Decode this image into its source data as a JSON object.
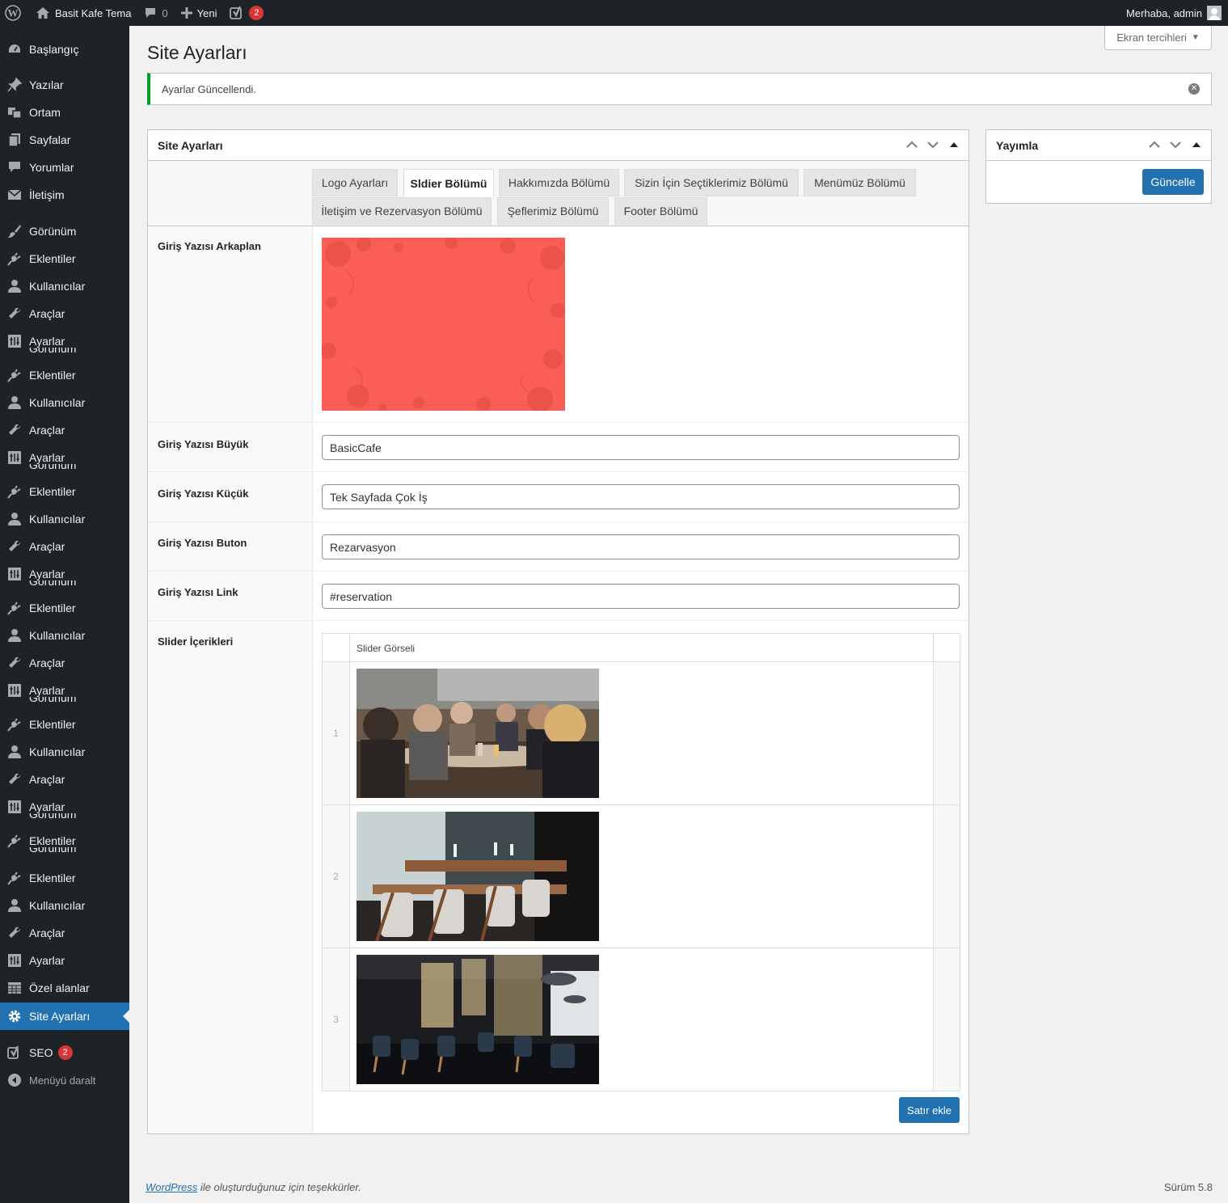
{
  "adminbar": {
    "site_name": "Basit Kafe Tema",
    "comments_count": "0",
    "new_label": "Yeni",
    "yoast_count": "2",
    "greeting": "Merhaba, admin"
  },
  "sidebar": {
    "items": [
      {
        "label": "Başlangıç",
        "icon": "dashboard-icon"
      },
      {
        "label": "Yazılar",
        "icon": "pin-icon"
      },
      {
        "label": "Ortam",
        "icon": "media-icon"
      },
      {
        "label": "Sayfalar",
        "icon": "pages-icon"
      },
      {
        "label": "Yorumlar",
        "icon": "comment-icon"
      },
      {
        "label": "İletişim",
        "icon": "mail-icon"
      },
      {
        "label": "Görünüm",
        "icon": "brush-icon"
      },
      {
        "label": "Eklentiler",
        "icon": "plugin-icon"
      },
      {
        "label": "Kullanıcılar",
        "icon": "user-icon"
      },
      {
        "label": "Araçlar",
        "icon": "wrench-icon"
      },
      {
        "label": "Ayarlar",
        "icon": "settings-grid-icon"
      },
      {
        "label": "Eklentiler",
        "icon": "plugin-icon"
      },
      {
        "label": "Kullanıcılar",
        "icon": "user-icon"
      },
      {
        "label": "Araçlar",
        "icon": "wrench-icon"
      },
      {
        "label": "Ayarlar",
        "icon": "settings-grid-icon"
      },
      {
        "label": "Eklentiler",
        "icon": "plugin-icon"
      },
      {
        "label": "Kullanıcılar",
        "icon": "user-icon"
      },
      {
        "label": "Araçlar",
        "icon": "wrench-icon"
      },
      {
        "label": "Ayarlar",
        "icon": "settings-grid-icon"
      },
      {
        "label": "Eklentiler",
        "icon": "plugin-icon"
      },
      {
        "label": "Kullanıcılar",
        "icon": "user-icon"
      },
      {
        "label": "Araçlar",
        "icon": "wrench-icon"
      },
      {
        "label": "Ayarlar",
        "icon": "settings-grid-icon"
      },
      {
        "label": "Eklentiler",
        "icon": "plugin-icon"
      },
      {
        "label": "Kullanıcılar",
        "icon": "user-icon"
      },
      {
        "label": "Araçlar",
        "icon": "wrench-icon"
      },
      {
        "label": "Ayarlar",
        "icon": "settings-grid-icon"
      },
      {
        "label": "Eklentiler",
        "icon": "plugin-icon"
      },
      {
        "label": "Eklentiler",
        "icon": "plugin-icon"
      },
      {
        "label": "Kullanıcılar",
        "icon": "user-icon"
      },
      {
        "label": "Araçlar",
        "icon": "wrench-icon"
      },
      {
        "label": "Ayarlar",
        "icon": "settings-grid-icon"
      },
      {
        "label": "Özel alanlar",
        "icon": "table-icon"
      },
      {
        "label": "Site Ayarları",
        "icon": "gear-icon"
      },
      {
        "label": "SEO",
        "icon": "yoast-icon",
        "badge": "2"
      },
      {
        "label": "Menüyü daralt",
        "icon": "collapse-icon"
      }
    ],
    "overlap_text": "Görünüm"
  },
  "screen_options": "Ekran tercihleri",
  "page_title": "Site Ayarları",
  "notice": "Ayarlar Güncellendi.",
  "main_box": {
    "title": "Site Ayarları",
    "tabs": [
      "Logo Ayarları",
      "Sldier Bölümü",
      "Hakkımızda Bölümü",
      "Sizin İçin Seçtiklerimiz Bölümü",
      "Menümüz Bölümü",
      "İletişim ve Rezervasyon Bölümü",
      "Şeflerimiz Bölümü",
      "Footer Bölümü"
    ],
    "active_tab": "Sldier Bölümü",
    "fields": {
      "bg_label": "Giriş Yazısı Arkaplan",
      "big_label": "Giriş Yazısı Büyük",
      "big_value": "BasicCafe",
      "small_label": "Giriş Yazısı Küçük",
      "small_value": "Tek Sayfada Çok İş",
      "button_label": "Giriş Yazısı Buton",
      "button_value": "Rezarvasyon",
      "link_label": "Giriş Yazısı Link",
      "link_value": "#reservation",
      "slider_label": "Slider İçerikleri"
    },
    "repeater": {
      "column": "Slider Görseli",
      "rows": [
        "1",
        "2",
        "3"
      ],
      "add_row": "Satır ekle"
    }
  },
  "publish_box": {
    "title": "Yayımla",
    "update": "Güncelle"
  },
  "footer": {
    "link": "WordPress",
    "thanks": " ile oluşturduğunuz için teşekkürler.",
    "version": "Sürüm 5.8"
  },
  "colors": {
    "admin_dark": "#1d2327",
    "accent": "#2271b1",
    "notice_success": "#00a32a",
    "badge": "#d63638",
    "hero_bg": "#fa5e55"
  }
}
